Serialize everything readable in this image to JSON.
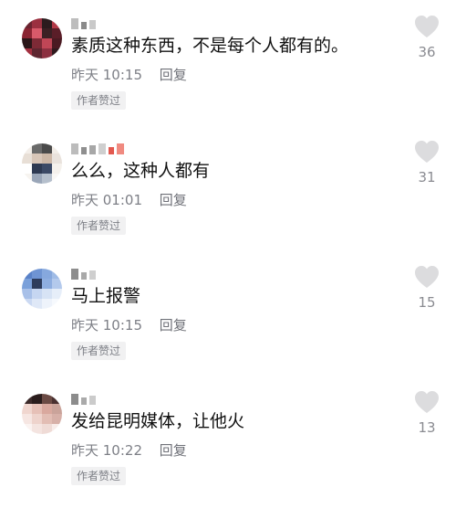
{
  "comments": [
    {
      "text": "素质这种东西，不是每个人都有的。",
      "time": "昨天 10:15",
      "reply_label": "回复",
      "badge": "作者赞过",
      "likes": "36",
      "avatar_colors": [
        "#6b2430",
        "#9b3040",
        "#2b1b1e",
        "#b23a48",
        "#8a2432",
        "#d85a6a",
        "#3b2024",
        "#5a1e28",
        "#2a1618",
        "#7d2a36",
        "#c04656",
        "#4a1a22",
        "#a33040",
        "#5e2630",
        "#8c3040",
        "#2f1a1e"
      ],
      "name_colors": [
        "#bdbdbd",
        "#8a8a8a",
        "#c9c9c9"
      ]
    },
    {
      "text": "么么，这种人都有",
      "time": "昨天 01:01",
      "reply_label": "回复",
      "badge": "作者赞过",
      "likes": "31",
      "avatar_colors": [
        "#f3eee9",
        "#6a6a6a",
        "#4a4a4a",
        "#f1ece6",
        "#e8dfd6",
        "#d8c6b8",
        "#cdb8a7",
        "#e9e2dc",
        "#ffffff",
        "#2e3a52",
        "#3c4a66",
        "#f5f1ec",
        "#f7f4f0",
        "#9aa6b8",
        "#b5bfcc",
        "#f9f7f4"
      ],
      "name_colors": [
        "#bcbcbc",
        "#8f8f8f",
        "#a7a7a7",
        "#cfcfcf",
        "#e3594f",
        "#f08a80"
      ]
    },
    {
      "text": "马上报警",
      "time": "昨天 10:15",
      "reply_label": "回复",
      "badge": "作者赞过",
      "likes": "15",
      "avatar_colors": [
        "#5a82c8",
        "#6f94d3",
        "#86a8de",
        "#9fbbe6",
        "#7aa0da",
        "#2d3c5c",
        "#8eaee0",
        "#b3c9ec",
        "#a8c0e8",
        "#c6d6f1",
        "#d7e3f5",
        "#e6eef9",
        "#cbd9f2",
        "#dfe8f7",
        "#eef3fb",
        "#f6f9fd"
      ],
      "name_colors": [
        "#8d8d8d",
        "#a9a9a9",
        "#cfcfcf"
      ]
    },
    {
      "text": "发给昆明媒体，让他火",
      "time": "昨天 10:22",
      "reply_label": "回复",
      "badge": "作者赞过",
      "likes": "13",
      "avatar_colors": [
        "#3c2a2a",
        "#2a1c1c",
        "#6b4a44",
        "#4a3030",
        "#f0d6cf",
        "#e6c0b7",
        "#d9a89e",
        "#caa39a",
        "#f6e6e2",
        "#eed3cc",
        "#e2bdb4",
        "#d7b0a8",
        "#fbf3f1",
        "#f4e4e0",
        "#efdbd6",
        "#f8ece9"
      ],
      "name_colors": [
        "#8c8c8c",
        "#aaaaaa",
        "#cbcbcb"
      ]
    }
  ]
}
